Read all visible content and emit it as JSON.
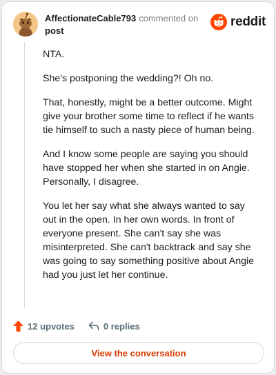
{
  "header": {
    "author": "AffectionateCable793",
    "commented_text": "commented on",
    "post_link": "post",
    "logo_text": "reddit"
  },
  "comment": {
    "paragraphs": [
      "NTA.",
      "She's postponing the wedding?! Oh no.",
      "That, honestly, might be a better outcome. Might give your brother some time to reflect if he wants tie himself to such a nasty piece of human being.",
      "And I know some people are saying you should have stopped her when she started in on Angie. Personally, I disagree.",
      "You let her say what she always wanted to say out in the open. In her own words. In front of everyone present. She can't say she was misinterpreted. She can't backtrack and say she was going to say something positive about Angie had you just let her continue."
    ]
  },
  "footer": {
    "upvotes": "12 upvotes",
    "replies": "0 replies",
    "cta": "View the conversation"
  },
  "colors": {
    "brand": "#ff4500",
    "cta_text": "#d93a00",
    "upvote_arrow": "#ff4500",
    "meta_text": "#576f76"
  },
  "icons": [
    "avatar-snoo-icon",
    "reddit-snoo-icon",
    "upvote-arrow-icon",
    "reply-arrow-icon"
  ]
}
